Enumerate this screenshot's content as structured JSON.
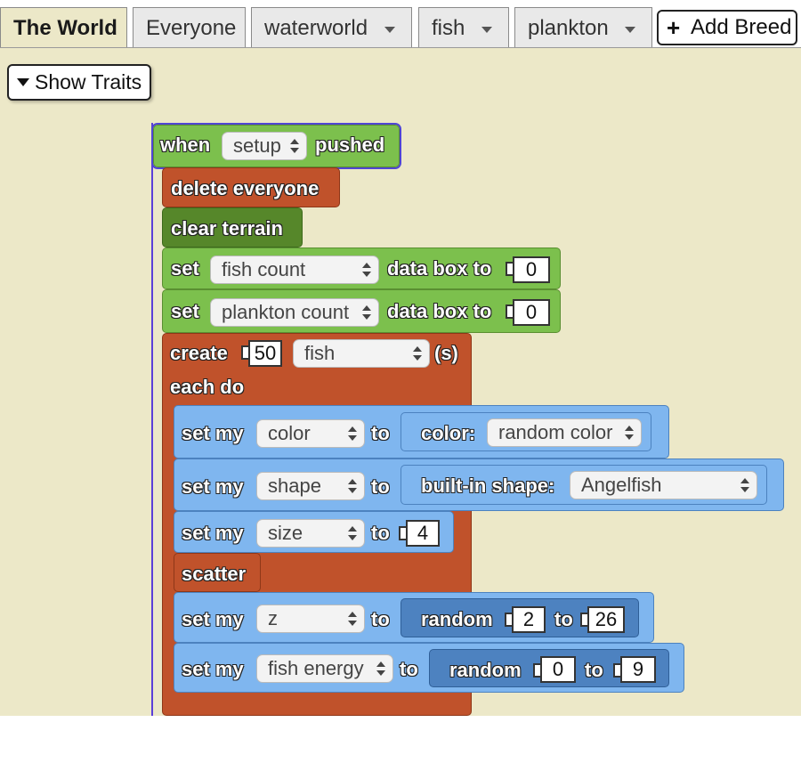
{
  "tabs": [
    {
      "label": "The World",
      "active": true
    },
    {
      "label": "Everyone"
    },
    {
      "label": "waterworld"
    },
    {
      "label": "fish"
    },
    {
      "label": "plankton"
    }
  ],
  "add_breed_label": "Add Breed",
  "show_traits_label": "Show Traits",
  "colors": {
    "workspace_bg": "#ece8c8",
    "event_block": "#7cc04d",
    "agent_block": "#c0522b",
    "trait_block": "#7fb6ef",
    "terrain_block": "#56872a"
  },
  "blocks": {
    "when_kw": "when",
    "setup_value": "setup",
    "pushed_kw": "pushed",
    "delete_everyone": "delete everyone",
    "clear_terrain": "clear terrain",
    "set_kw": "set",
    "data_box_to_kw": "data box to",
    "set_fish_count": {
      "target": "fish count",
      "value": "0"
    },
    "set_plankton_count": {
      "target": "plankton count",
      "value": "0"
    },
    "create_kw": "create",
    "create_count": "50",
    "create_breed": "fish",
    "s_kw": "(s)",
    "each_do_kw": "each do",
    "set_my_kw": "set my",
    "to_kw": "to",
    "color_row": {
      "trait": "color",
      "fn_label": "color:",
      "fn_value": "random color"
    },
    "shape_row": {
      "trait": "shape",
      "fn_label": "built-in shape:",
      "fn_value": "Angelfish"
    },
    "size_row": {
      "trait": "size",
      "value": "4"
    },
    "scatter": "scatter",
    "z_row": {
      "trait": "z",
      "fn": "random",
      "from": "2",
      "to": "26"
    },
    "energy_row": {
      "trait": "fish energy",
      "fn": "random",
      "from": "0",
      "to": "9"
    }
  }
}
